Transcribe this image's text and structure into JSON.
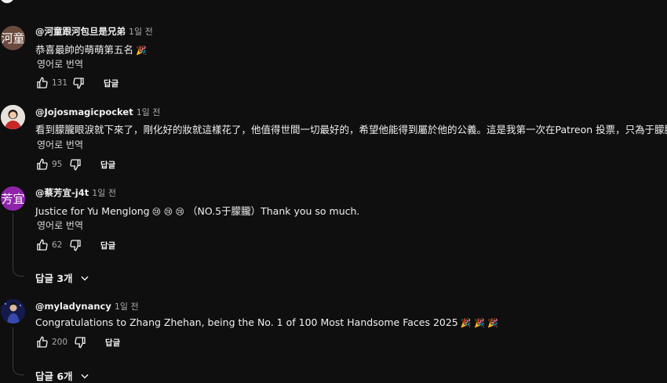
{
  "comments": [
    {
      "avatar_text": "河童",
      "avatar_color": "#6b4a3e",
      "handle": "@河童跟河包旦是兄弟",
      "time": "1일 전",
      "text": "恭喜最帥的萌萌第五名",
      "emoji": "🎉",
      "translate": "영어로 번역",
      "likes": "131",
      "reply": "답글"
    },
    {
      "avatar_text": "",
      "avatar_color": "#e8e2dc",
      "handle": "@Jojosmagicpocket",
      "time": "1일 전",
      "text": "看到朦朧眼淚就下來了，剛化好的妝就這樣花了，他值得世間一切最好的，希望他能得到屬於他的公義。這是我第一次在Patreon 投票，只為于朦朧",
      "translate": "영어로 번역",
      "likes": "95",
      "reply": "답글"
    },
    {
      "avatar_text": "芳宜",
      "avatar_color": "#8e24aa",
      "handle": "@蔡芳宜-j4t",
      "time": "1일 전",
      "text": "Justice for Yu Menglong",
      "emoji": "😢 😢 😢",
      "text_after": "（NO.5于朦朧）Thank you so much.",
      "translate": "영어로 번역",
      "likes": "62",
      "reply": "답글",
      "replies_label": "답글 3개"
    },
    {
      "avatar_text": "",
      "avatar_color": "#1a237e",
      "handle": "@myladynancy",
      "time": "1일 전",
      "text": "Congratulations to Zhang Zhehan, being the No. 1 of 100 Most Handsome Faces 2025",
      "emoji": "🎉 🎉 🎉",
      "likes": "200",
      "reply": "답글",
      "replies_label": "답글 6개"
    }
  ]
}
